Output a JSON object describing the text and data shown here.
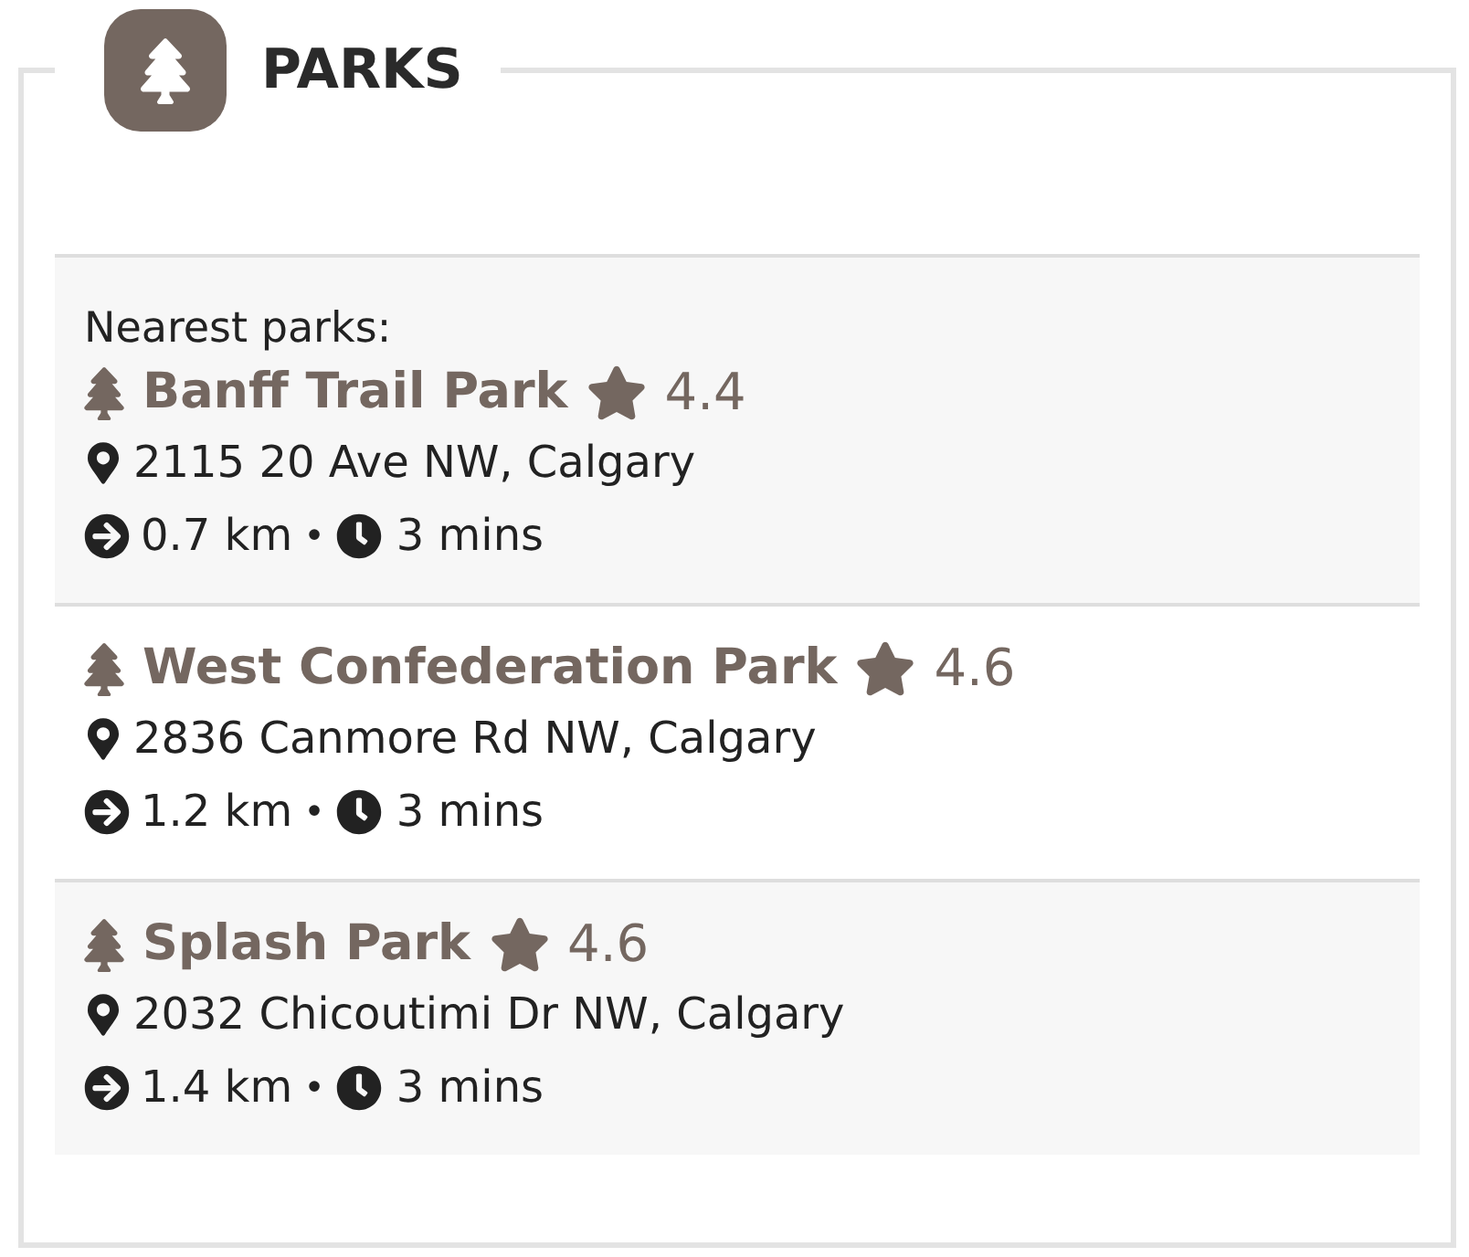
{
  "header": {
    "title": "PARKS"
  },
  "intro": "Nearest parks:",
  "parks": [
    {
      "name": "Banff Trail Park",
      "rating": "4.4",
      "address": "2115 20 Ave NW, Calgary",
      "distance": "0.7 km",
      "separator": "•",
      "time": "3 mins"
    },
    {
      "name": "West Confederation Park",
      "rating": "4.6",
      "address": "2836 Canmore Rd NW, Calgary",
      "distance": "1.2 km",
      "separator": "•",
      "time": "3 mins"
    },
    {
      "name": "Splash Park",
      "rating": "4.6",
      "address": "2032 Chicoutimi Dr NW, Calgary",
      "distance": "1.4 km",
      "separator": "•",
      "time": "3 mins"
    }
  ]
}
